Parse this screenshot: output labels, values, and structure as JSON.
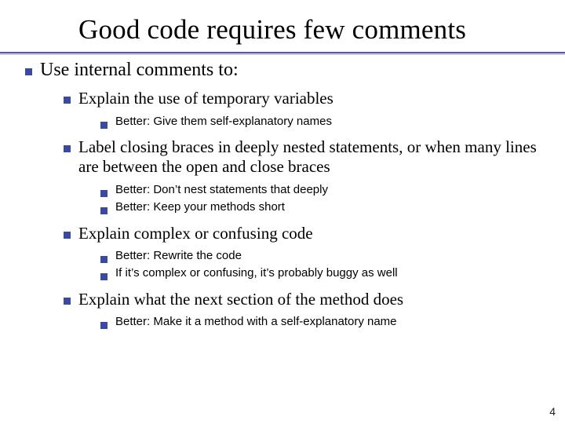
{
  "title": "Good code requires few comments",
  "page_number": "4",
  "list_lvl1": "Use internal comments to:",
  "lvl2": {
    "a": "Explain the use of temporary variables",
    "b": "Label closing braces in deeply nested statements, or when many lines are between the open and close braces",
    "c": "Explain complex or confusing code",
    "d": "Explain what the next section of the method does"
  },
  "lvl3": {
    "a1": "Better: Give them self-explanatory names",
    "b1": "Better: Don’t nest statements that deeply",
    "b2": "Better: Keep your methods short",
    "c1": "Better: Rewrite the code",
    "c2": "If it’s complex or confusing, it’s probably buggy as well",
    "d1": "Better: Make it a method with a self-explanatory name"
  }
}
